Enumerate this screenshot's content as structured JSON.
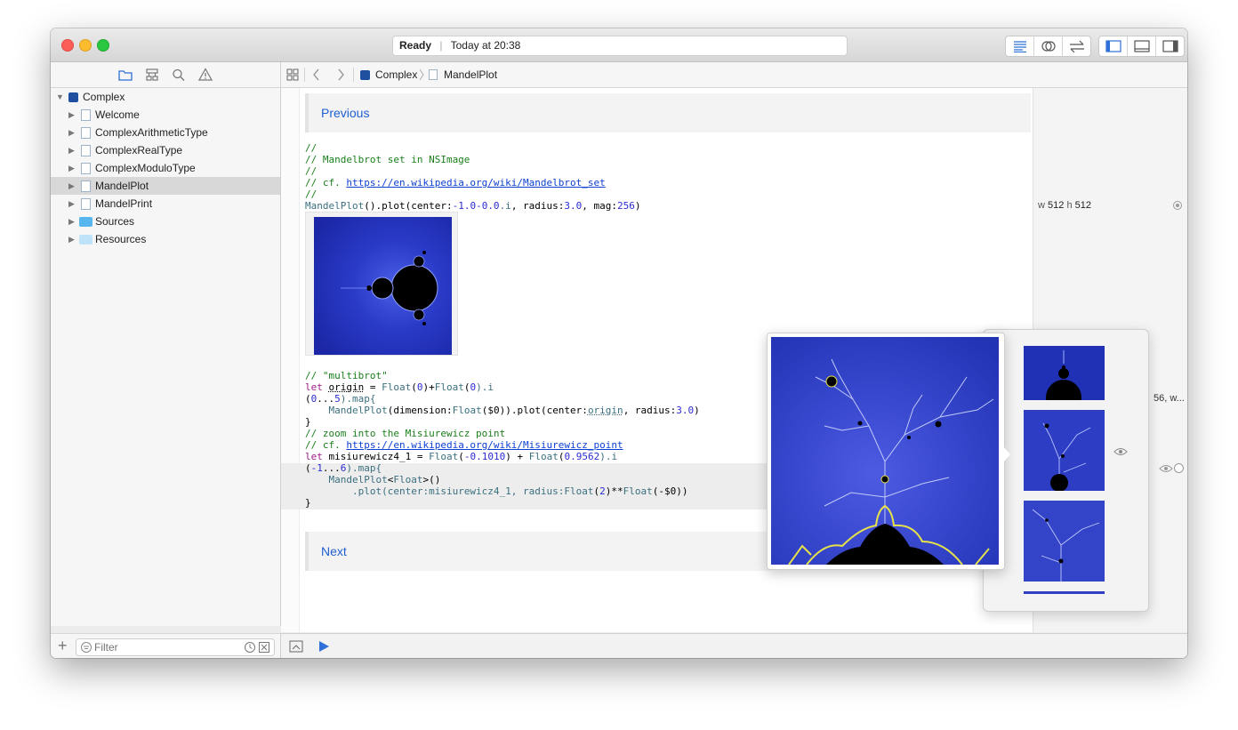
{
  "window": {
    "status_ready": "Ready",
    "status_time": "Today at 20:38"
  },
  "navigator": {
    "icons": [
      "folder-icon",
      "hierarchy-icon",
      "search-icon",
      "warning-icon"
    ],
    "tree": [
      {
        "label": "Complex",
        "kind": "root",
        "selected": false
      },
      {
        "label": "Welcome",
        "kind": "page",
        "selected": false
      },
      {
        "label": "ComplexArithmeticType",
        "kind": "page",
        "selected": false
      },
      {
        "label": "ComplexRealType",
        "kind": "page",
        "selected": false
      },
      {
        "label": "ComplexModuloType",
        "kind": "page",
        "selected": false
      },
      {
        "label": "MandelPlot",
        "kind": "page",
        "selected": true
      },
      {
        "label": "MandelPrint",
        "kind": "page",
        "selected": false
      },
      {
        "label": "Sources",
        "kind": "folder",
        "selected": false
      },
      {
        "label": "Resources",
        "kind": "folder",
        "selected": false
      }
    ],
    "filter_placeholder": "Filter"
  },
  "jumpbar": {
    "crumbs": [
      "Complex",
      "MandelPlot"
    ]
  },
  "editor": {
    "previous_link": "Previous",
    "next_link": "Next",
    "block1": {
      "c1": "//",
      "c2": "// Mandelbrot set in NSImage",
      "c3": "//",
      "c4_prefix": "// cf. ",
      "c4_link": "https://en.wikipedia.org/wiki/Mandelbrot_set",
      "c5": "//",
      "l6_a": "MandelPlot",
      "l6_b": "().plot(center:",
      "l6_c": "-1.0-0.0",
      "l6_d": ".i",
      "l6_e": ", radius:",
      "l6_f": "3.0",
      "l6_g": ", mag:",
      "l6_h": "256",
      "l6_i": ")"
    },
    "block2": {
      "c1": "// \"multibrot\"",
      "l2_a": "let ",
      "l2_b": "origin",
      "l2_c": " = ",
      "l2_d": "Float",
      "l2_e": "(",
      "l2_f": "0",
      "l2_g": ")+",
      "l2_h": "Float",
      "l2_i": "(",
      "l2_j": "0",
      "l2_k": ").i",
      "l3_a": "(",
      "l3_b": "0",
      "l3_c": "...",
      "l3_d": "5",
      "l3_e": ").map{",
      "l4_a": "    ",
      "l4_b": "MandelPlot",
      "l4_c": "(dimension:",
      "l4_d": "Float",
      "l4_e": "($0)).plot(center:",
      "l4_f": "origin",
      "l4_g": ", radius:",
      "l4_h": "3.0",
      "l4_i": ")",
      "l5": "}",
      "c6": "// zoom into the Misiurewicz point",
      "c7_prefix": "// cf. ",
      "c7_link": "https://en.wikipedia.org/wiki/Misiurewicz_point",
      "l8_a": "let ",
      "l8_b": "misiurewicz4_1",
      "l8_c": " = ",
      "l8_d": "Float",
      "l8_e": "(",
      "l8_f": "-0.1010",
      "l8_g": ") + ",
      "l8_h": "Float",
      "l8_i": "(",
      "l8_j": "0.9562",
      "l8_k": ").i",
      "l9_a": "(",
      "l9_b": "-1",
      "l9_c": "...",
      "l9_d": "6",
      "l9_e": ").map{",
      "l10_a": "    ",
      "l10_b": "MandelPlot",
      "l10_c": "<",
      "l10_d": "Float",
      "l10_e": ">()",
      "l11_a": "        .plot(center:",
      "l11_b": "misiurewicz4_1",
      "l11_c": ", radius:",
      "l11_d": "Float",
      "l11_e": "(",
      "l11_f": "2",
      "l11_g": ")**",
      "l11_h": "Float",
      "l11_i": "(-$0))",
      "l12": "}"
    }
  },
  "results": {
    "line1_w": "w",
    "line1_wval": "512",
    "line1_h": "h",
    "line1_hval": "512",
    "line2": "56, w..."
  },
  "colors": {
    "accent": "#1f5fd1",
    "mandel_bg": "#1f2db0",
    "mandel_set": "#000000",
    "fractal_edge": "#e6e24a"
  }
}
